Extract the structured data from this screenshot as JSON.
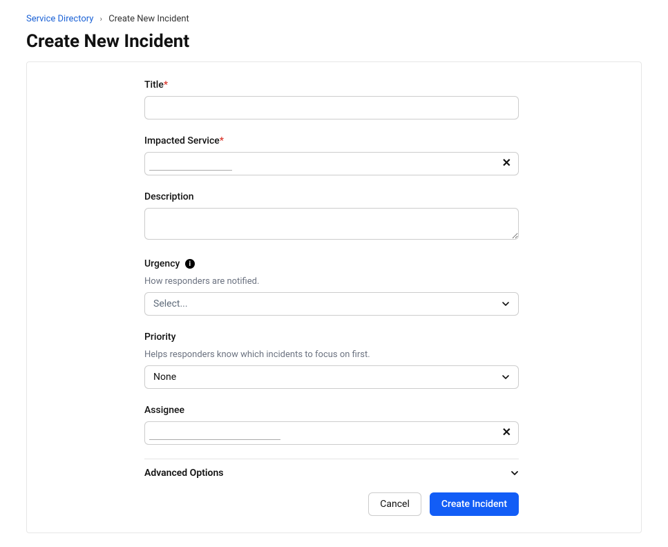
{
  "breadcrumb": {
    "root": "Service Directory",
    "current": "Create New Incident"
  },
  "page": {
    "title": "Create New Incident"
  },
  "form": {
    "title": {
      "label": "Title",
      "value": ""
    },
    "impacted_service": {
      "label": "Impacted Service",
      "value": ""
    },
    "description": {
      "label": "Description",
      "value": ""
    },
    "urgency": {
      "label": "Urgency",
      "helper": "How responders are notified.",
      "placeholder": "Select...",
      "value": ""
    },
    "priority": {
      "label": "Priority",
      "helper": "Helps responders know which incidents to focus on first.",
      "value": "None"
    },
    "assignee": {
      "label": "Assignee",
      "value": ""
    },
    "advanced": {
      "label": "Advanced Options"
    }
  },
  "actions": {
    "cancel": "Cancel",
    "submit": "Create Incident"
  }
}
